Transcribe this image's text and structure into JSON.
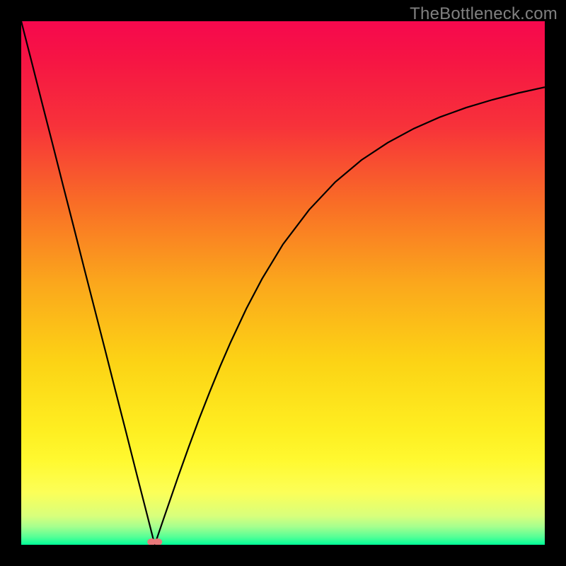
{
  "watermark": "TheBottleneck.com",
  "chart_data": {
    "type": "line",
    "title": "",
    "xlabel": "",
    "ylabel": "",
    "xlim": [
      0,
      100
    ],
    "ylim": [
      0,
      100
    ],
    "grid": false,
    "legend": false,
    "annotations": [],
    "background_gradient": {
      "stops": [
        {
          "offset": 0.0,
          "color": "#f6084e"
        },
        {
          "offset": 0.07,
          "color": "#f61444"
        },
        {
          "offset": 0.2,
          "color": "#f7323a"
        },
        {
          "offset": 0.35,
          "color": "#f96e26"
        },
        {
          "offset": 0.5,
          "color": "#fba71c"
        },
        {
          "offset": 0.65,
          "color": "#fcd315"
        },
        {
          "offset": 0.78,
          "color": "#feee21"
        },
        {
          "offset": 0.84,
          "color": "#fff930"
        },
        {
          "offset": 0.9,
          "color": "#fcff58"
        },
        {
          "offset": 0.945,
          "color": "#d8ff7c"
        },
        {
          "offset": 0.965,
          "color": "#a7ff8e"
        },
        {
          "offset": 0.985,
          "color": "#56ff96"
        },
        {
          "offset": 1.0,
          "color": "#00ff98"
        }
      ]
    },
    "series": [
      {
        "name": "curve",
        "color": "#000000",
        "x": [
          0.0,
          2.0,
          4.0,
          6.0,
          8.0,
          10.0,
          12.0,
          14.0,
          16.0,
          18.0,
          20.0,
          22.0,
          24.0,
          25.5,
          27.0,
          28.0,
          30.0,
          32.0,
          34.0,
          36.0,
          38.0,
          40.0,
          43.0,
          46.0,
          50.0,
          55.0,
          60.0,
          65.0,
          70.0,
          75.0,
          80.0,
          85.0,
          90.0,
          95.0,
          100.0
        ],
        "y": [
          100.0,
          92.2,
          84.3,
          76.5,
          68.6,
          60.8,
          52.9,
          45.1,
          37.3,
          29.4,
          21.6,
          13.7,
          5.9,
          0.0,
          4.4,
          7.3,
          13.1,
          18.7,
          24.1,
          29.2,
          34.1,
          38.7,
          45.1,
          50.8,
          57.4,
          64.0,
          69.3,
          73.5,
          76.8,
          79.5,
          81.7,
          83.5,
          85.0,
          86.3,
          87.4
        ]
      }
    ],
    "marker": {
      "x": 25.5,
      "y": 0.0,
      "color": "#e8787a",
      "shape": "double-dot"
    }
  }
}
